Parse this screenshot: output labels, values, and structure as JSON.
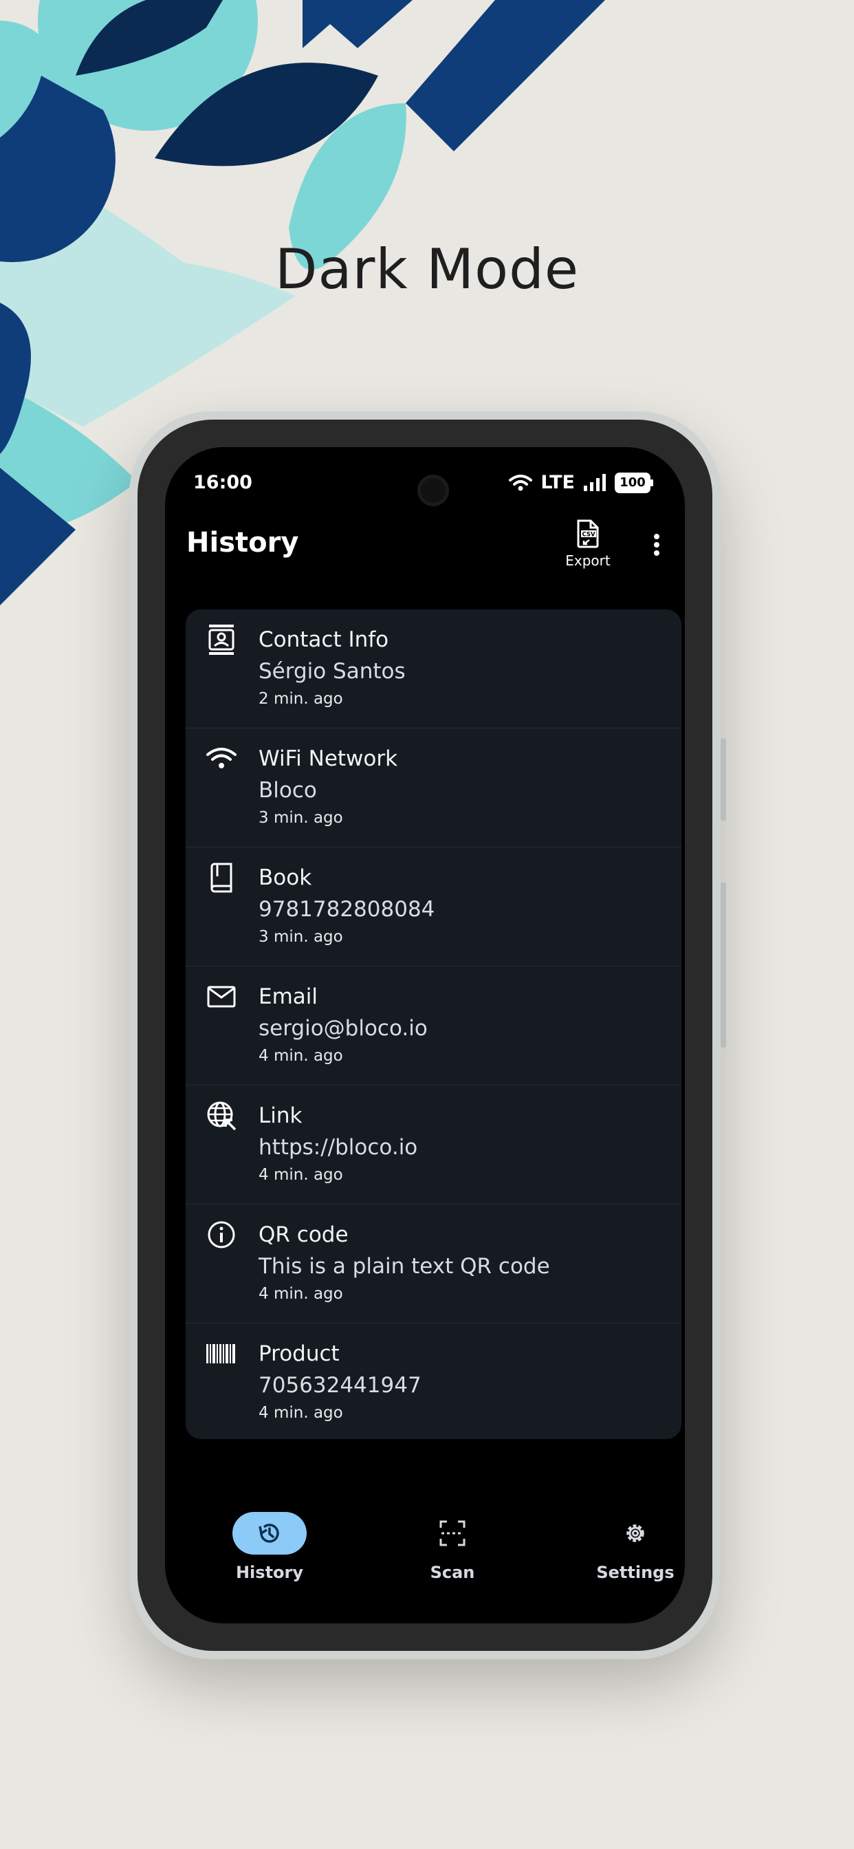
{
  "headline": "Dark Mode",
  "status_bar": {
    "time": "16:00",
    "network": "LTE",
    "battery": "100"
  },
  "app_bar": {
    "title": "History",
    "export_label": "Export",
    "export_icon": "csv-file-icon",
    "more_icon": "more-vert-icon"
  },
  "history_items": [
    {
      "icon": "contact-icon",
      "title": "Contact Info",
      "value": "Sérgio Santos",
      "time": "2 min. ago"
    },
    {
      "icon": "wifi-icon",
      "title": "WiFi Network",
      "value": "Bloco",
      "time": "3 min. ago"
    },
    {
      "icon": "book-icon",
      "title": "Book",
      "value": "9781782808084",
      "time": "3 min. ago"
    },
    {
      "icon": "email-icon",
      "title": "Email",
      "value": "sergio@bloco.io",
      "time": "4 min. ago"
    },
    {
      "icon": "link-icon",
      "title": "Link",
      "value": "https://bloco.io",
      "time": "4 min. ago"
    },
    {
      "icon": "info-icon",
      "title": "QR code",
      "value": "This is a plain text QR code",
      "time": "4 min. ago"
    },
    {
      "icon": "barcode-icon",
      "title": "Product",
      "value": "705632441947",
      "time": "4 min. ago"
    }
  ],
  "bottom_nav": [
    {
      "label": "History",
      "icon": "history-icon",
      "active": true
    },
    {
      "label": "Scan",
      "icon": "scan-icon",
      "active": false
    },
    {
      "label": "Settings",
      "icon": "gear-icon",
      "active": false
    }
  ],
  "colors": {
    "background": "#e9e7e1",
    "dark_navy": "#0a2a52",
    "navy": "#0f3d7a",
    "teal": "#7dd6d6",
    "light_teal": "#bfe6e4",
    "card": "#161b22",
    "accent": "#8ccaf7"
  }
}
